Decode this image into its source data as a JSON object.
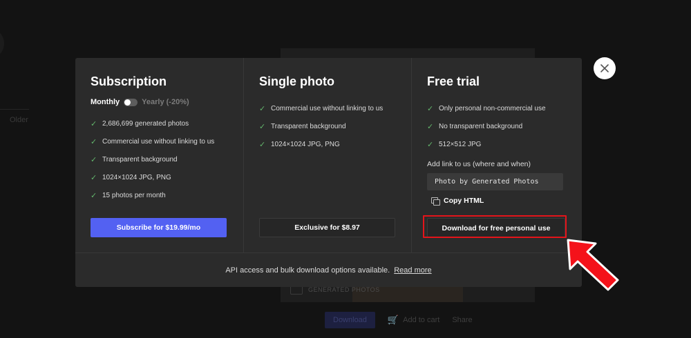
{
  "background": {
    "tab_label": "Older",
    "watermark_text": "GENERATED PHOTOS",
    "download_label": "Download",
    "add_to_cart_label": "Add to cart",
    "share_label": "Share"
  },
  "modal": {
    "subscription": {
      "title": "Subscription",
      "billing_monthly": "Monthly",
      "billing_yearly": "Yearly (-20%)",
      "features": [
        "2,686,699 generated photos",
        "Commercial use without linking to us",
        "Transparent background",
        "1024×1024 JPG, PNG",
        "15 photos per month"
      ],
      "cta_label": "Subscribe for $19.99/mo"
    },
    "single_photo": {
      "title": "Single photo",
      "features": [
        "Commercial use without linking to us",
        "Transparent background",
        "1024×1024 JPG, PNG"
      ],
      "cta_label": "Exclusive for $8.97"
    },
    "free_trial": {
      "title": "Free trial",
      "features": [
        "Only personal non-commercial use",
        "No transparent background",
        "512×512 JPG"
      ],
      "attribution_label": "Add link to us (where and when)",
      "attribution_text": "Photo by Generated Photos",
      "copy_html_label": "Copy HTML",
      "cta_label": "Download for free personal use"
    },
    "footer": {
      "text": "API access and bulk download options available.",
      "link_label": "Read more"
    }
  },
  "colors": {
    "accent_blue": "#5361f2",
    "check_green": "#63b66c",
    "highlight_red": "#e5141a",
    "modal_bg": "#2b2b2b"
  },
  "icons": {
    "close": "close-icon",
    "check": "check-icon",
    "copy": "copy-icon",
    "annotation_arrow": "arrow-pointer-icon"
  }
}
